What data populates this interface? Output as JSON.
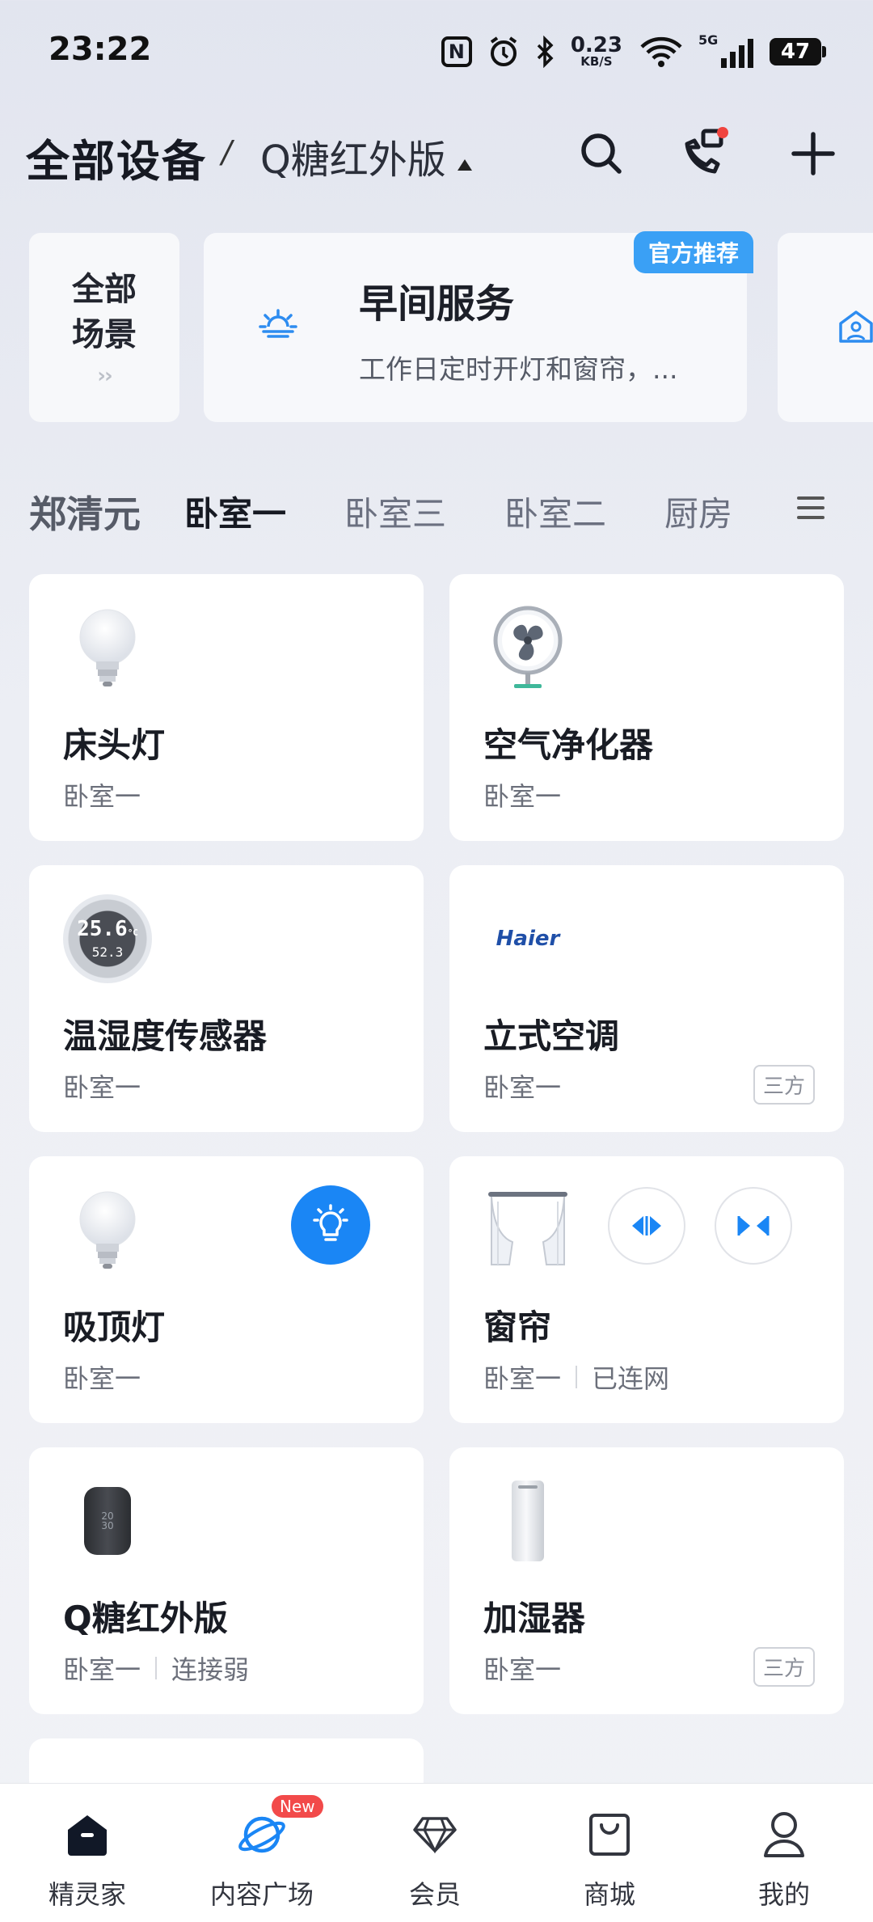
{
  "status_bar": {
    "time": "23:22",
    "speed_value": "0.23",
    "speed_unit": "KB/S",
    "network": "5G",
    "battery": "47"
  },
  "header": {
    "title": "全部设备",
    "separator": "/",
    "home_name": "Q糖红外版"
  },
  "scenes": {
    "all_line1": "全部",
    "all_line2": "场景",
    "featured": {
      "badge": "官方推荐",
      "name": "早间服务",
      "desc": "工作日定时开灯和窗帘，..."
    }
  },
  "rooms": {
    "owner": "郑清元",
    "tabs": [
      "卧室一",
      "卧室三",
      "卧室二",
      "厨房"
    ],
    "active_tab": 0
  },
  "devices": [
    {
      "name": "床头灯",
      "room": "卧室一",
      "icon": "bulb-icon"
    },
    {
      "name": "空气净化器",
      "room": "卧室一",
      "icon": "fan-icon"
    },
    {
      "name": "温湿度传感器",
      "room": "卧室一",
      "icon": "thermometer-icon",
      "temp": "25.6",
      "unit": "°C",
      "humidity": "52.3"
    },
    {
      "name": "立式空调",
      "room": "卧室一",
      "icon": "haier-logo",
      "brand": "Haier",
      "tag": "三方"
    },
    {
      "name": "吸顶灯",
      "room": "卧室一",
      "icon": "bulb-icon"
    },
    {
      "name": "窗帘",
      "room": "卧室一",
      "status": "已连网",
      "icon": "curtain-icon"
    },
    {
      "name": "Q糖红外版",
      "room": "卧室一",
      "status": "连接弱",
      "icon": "speaker-icon",
      "display": "20 30"
    },
    {
      "name": "加湿器",
      "room": "卧室一",
      "icon": "humidifier-icon",
      "tag": "三方"
    }
  ],
  "bottom_nav": {
    "items": [
      {
        "label": "精灵家",
        "icon": "home-icon"
      },
      {
        "label": "内容广场",
        "icon": "planet-icon",
        "badge": "New"
      },
      {
        "label": "会员",
        "icon": "diamond-icon"
      },
      {
        "label": "商城",
        "icon": "shopping-bag-icon"
      },
      {
        "label": "我的",
        "icon": "person-icon"
      }
    ],
    "active": 0
  },
  "colors": {
    "accent": "#1a86f5",
    "badge_blue": "#3aa0f5",
    "new_badge": "#f24a4a"
  }
}
